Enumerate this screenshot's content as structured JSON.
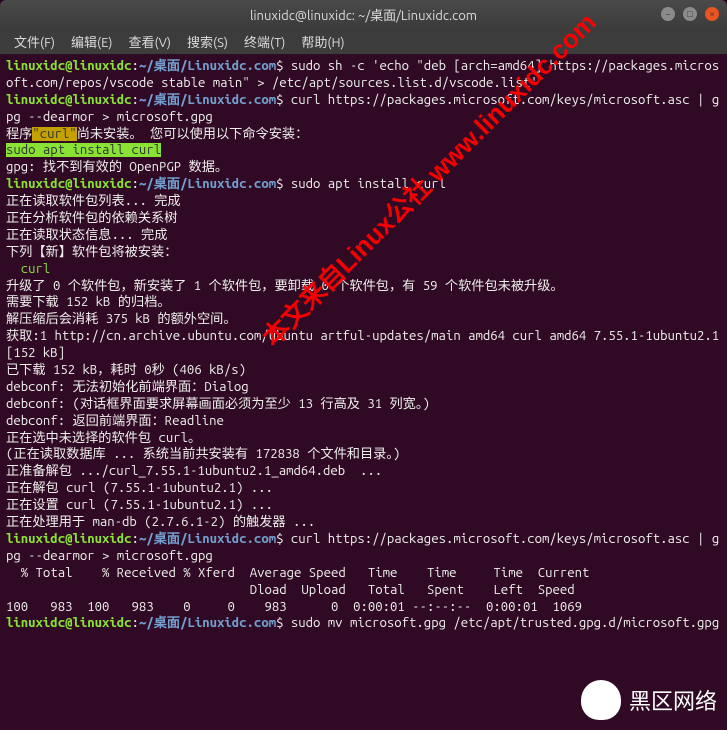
{
  "window": {
    "title": "linuxidc@linuxidc: ~/桌面/Linuxidc.com"
  },
  "menu": {
    "file": "文件(F)",
    "edit": "编辑(E)",
    "view": "查看(V)",
    "search": "搜索(S)",
    "terminal": "终端(T)",
    "help": "帮助(H)"
  },
  "prompt": {
    "user": "linuxidc@linuxidc",
    "colon": ":",
    "path": "~/桌面/Linuxidc.com",
    "symbol": "$"
  },
  "lines": {
    "cmd1": "sudo sh -c 'echo \"deb [arch=amd64] https://packages.microsoft.com/repos/vscode stable main\" > /etc/apt/sources.list.d/vscode.list'",
    "cmd2": "curl https://packages.microsoft.com/keys/microsoft.asc | gpg --dearmor > microsoft.gpg",
    "err_curl_a": "程序",
    "err_curl_b": "\"curl\"",
    "err_curl_c": "尚未安装。 您可以使用以下命令安装：",
    "suggest": "sudo apt install curl",
    "gpg_err": "gpg: 找不到有效的 OpenPGP 数据。",
    "cmd3": "sudo apt install curl",
    "reading_pkg": "正在读取软件包列表... 完成",
    "analyzing": "正在分析软件包的依赖关系树",
    "reading_state": "正在读取状态信息... 完成",
    "new_pkg_header": "下列【新】软件包将被安装：",
    "new_pkg": "  curl",
    "upgrade_summary": "升级了 0 个软件包，新安装了 1 个软件包，要卸载 0 个软件包，有 59 个软件包未被升级。",
    "download_size": "需要下载 152 kB 的归档。",
    "disk_space": "解压缩后会消耗 375 kB 的额外空间。",
    "get1": "获取:1 http://cn.archive.ubuntu.com/ubuntu artful-updates/main amd64 curl amd64 7.55.1-1ubuntu2.1 [152 kB]",
    "downloaded": "已下载 152 kB，耗时 0秒 (406 kB/s)",
    "debconf1": "debconf: 无法初始化前端界面：Dialog",
    "debconf2": "debconf: (对话框界面要求屏幕画面必须为至少 13 行高及 31 列宽。)",
    "debconf3": "debconf: 返回前端界面：Readline",
    "selecting": "正在选中未选择的软件包 curl。",
    "reading_db": "(正在读取数据库 ... 系统当前共安装有 172838 个文件和目录。)",
    "preparing": "正准备解包 .../curl_7.55.1-1ubuntu2.1_amd64.deb  ...",
    "unpacking": "正在解包 curl (7.55.1-1ubuntu2.1) ...",
    "setting_up": "正在设置 curl (7.55.1-1ubuntu2.1) ...",
    "man_db": "正在处理用于 man-db (2.7.6.1-2) 的触发器 ...",
    "cmd4": "curl https://packages.microsoft.com/keys/microsoft.asc | gpg --dearmor > microsoft.gpg",
    "curl_header": "  % Total    % Received % Xferd  Average Speed   Time    Time     Time  Current",
    "curl_header2": "                                 Dload  Upload   Total   Spent    Left  Speed",
    "curl_progress": "100   983  100   983    0     0    983      0  0:00:01 --:--:--  0:00:01  1069",
    "cmd5": "sudo mv microsoft.gpg /etc/apt/trusted.gpg.d/microsoft.gpg"
  },
  "watermark": "本文来自Linux公社 www.linuxidc.com",
  "logo": "黑区网络"
}
